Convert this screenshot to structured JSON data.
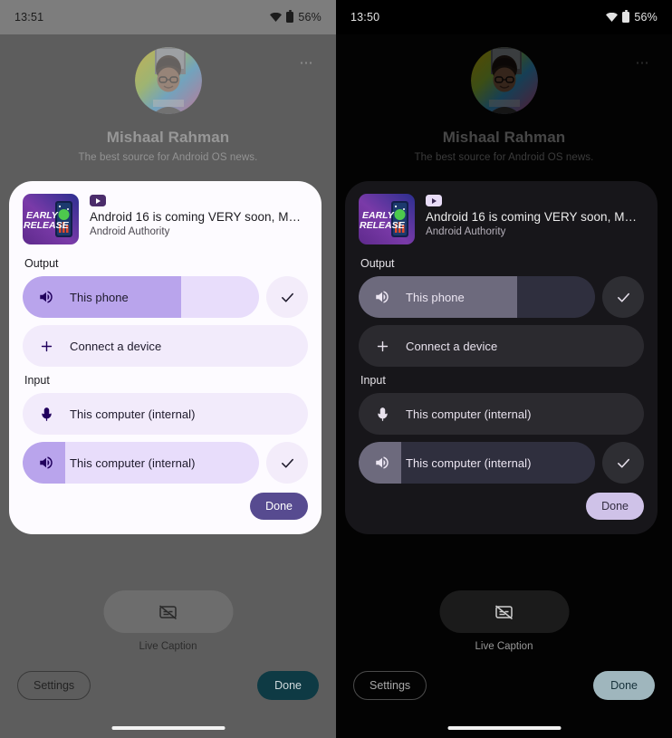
{
  "panels": [
    {
      "theme": "light",
      "status_bar": {
        "time": "13:51",
        "battery_percent": "56%",
        "wifi_icon": "wifi-icon",
        "battery_icon": "battery-icon"
      },
      "profile": {
        "name": "Mishaal Rahman",
        "subtitle": "The best source for Android OS news.",
        "avatar_icon": "avatar",
        "overflow_icon": "overflow-menu-icon"
      },
      "card": {
        "media": {
          "thumbnail_icon": "album-art",
          "thumbnail_text_line1": "EARLY",
          "thumbnail_text_line2": "RELEASE",
          "app_badge_icon": "youtube-play-icon",
          "title": "Android 16 is coming VERY soon, MU…",
          "artist": "Android Authority"
        },
        "output": {
          "label": "Output",
          "devices": [
            {
              "name": "This phone",
              "icon": "speaker-icon",
              "volume_percent": 67,
              "selected": true,
              "check_icon": "check-icon"
            }
          ],
          "connect": {
            "label": "Connect a device",
            "icon": "plus-icon"
          }
        },
        "input": {
          "label": "Input",
          "devices": [
            {
              "name": "This computer (internal)",
              "icon": "microphone-icon",
              "type": "plain"
            },
            {
              "name": "This computer (internal)",
              "icon": "speaker-icon",
              "type": "slider",
              "volume_percent": 18,
              "selected": true,
              "check_icon": "check-icon"
            }
          ]
        },
        "done_label": "Done"
      },
      "bottom": {
        "live_caption": {
          "label": "Live Caption",
          "icon": "live-caption-off-icon"
        },
        "settings_label": "Settings",
        "done_label": "Done"
      },
      "nav_handle_icon": "gesture-nav-handle"
    },
    {
      "theme": "dark",
      "status_bar": {
        "time": "13:50",
        "battery_percent": "56%",
        "wifi_icon": "wifi-icon",
        "battery_icon": "battery-icon"
      },
      "profile": {
        "name": "Mishaal Rahman",
        "subtitle": "The best source for Android OS news.",
        "avatar_icon": "avatar",
        "overflow_icon": "overflow-menu-icon"
      },
      "card": {
        "media": {
          "thumbnail_icon": "album-art",
          "thumbnail_text_line1": "EARLY",
          "thumbnail_text_line2": "RELEASE",
          "app_badge_icon": "youtube-play-icon",
          "title": "Android 16 is coming VERY soon, MU…",
          "artist": "Android Authority"
        },
        "output": {
          "label": "Output",
          "devices": [
            {
              "name": "This phone",
              "icon": "speaker-icon",
              "volume_percent": 67,
              "selected": true,
              "check_icon": "check-icon"
            }
          ],
          "connect": {
            "label": "Connect a device",
            "icon": "plus-icon"
          }
        },
        "input": {
          "label": "Input",
          "devices": [
            {
              "name": "This computer (internal)",
              "icon": "microphone-icon",
              "type": "plain"
            },
            {
              "name": "This computer (internal)",
              "icon": "speaker-icon",
              "type": "slider",
              "volume_percent": 18,
              "selected": true,
              "check_icon": "check-icon"
            }
          ]
        },
        "done_label": "Done"
      },
      "bottom": {
        "live_caption": {
          "label": "Live Caption",
          "icon": "live-caption-off-icon"
        },
        "settings_label": "Settings",
        "done_label": "Done"
      },
      "nav_handle_icon": "gesture-nav-handle"
    }
  ],
  "colors": {
    "light_card_bg": "#fdfbff",
    "light_slider_fill": "#b9a4ec",
    "light_slider_track": "#e8ddfb",
    "light_done_btn": "#574b90",
    "light_bottom_done": "#0e3a44",
    "dark_card_bg": "#17161a",
    "dark_slider_fill": "#6d6a7d",
    "dark_slider_track": "#2f2f3e",
    "dark_done_btn": "#cfc2e8",
    "dark_bottom_done": "#9fb6bd"
  }
}
